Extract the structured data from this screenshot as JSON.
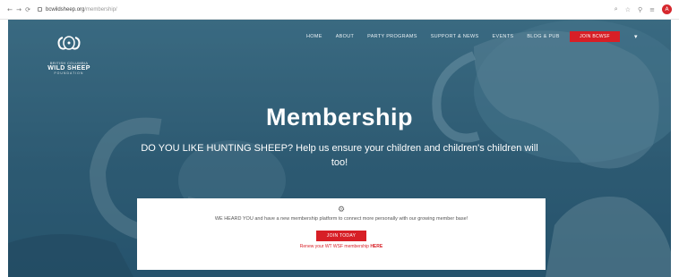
{
  "browser": {
    "url_host": "bcwildsheep.org",
    "url_path": "/membership/",
    "nav_back": "←",
    "nav_forward": "→",
    "nav_reload": "⟳",
    "icons": [
      "zoom-icon",
      "star-icon",
      "extensions-icon",
      "menu-icon"
    ],
    "profile_initial": "A"
  },
  "site": {
    "logo_small": "BRITISH COLUMBIA",
    "logo_big": "WILD SHEEP",
    "logo_sub": "FOUNDATION",
    "nav": [
      "HOME",
      "ABOUT",
      "PARTY PROGRAMS",
      "SUPPORT & NEWS",
      "EVENTS",
      "BLOG & PUB"
    ],
    "join_label": "JOIN BCWSF"
  },
  "hero": {
    "title": "Membership",
    "subtitle": "DO YOU LIKE HUNTING SHEEP? Help us ensure your children and children's children will too!"
  },
  "card": {
    "text": "WE HEARD YOU and have a new membership platform to connect more personally with our growing member base!",
    "button_label": "JOIN TODAY",
    "renew_text": "Renew your WT WSF membership",
    "renew_link": "HERE"
  },
  "colors": {
    "accent": "#d71f26",
    "hero_blue": "#2e5a72"
  }
}
